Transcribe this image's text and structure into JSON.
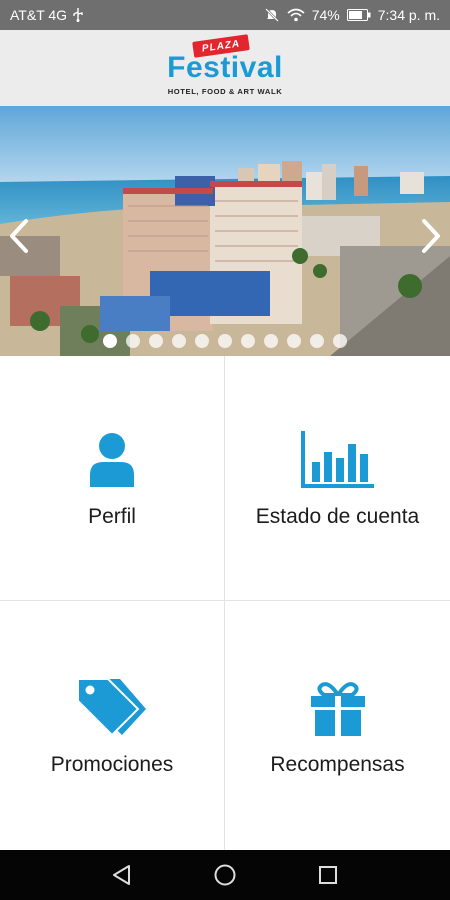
{
  "status_bar": {
    "carrier": "AT&T 4G",
    "battery": "74%",
    "time": "7:34 p. m.",
    "icons": [
      "usb-icon",
      "mute-icon",
      "wifi-icon",
      "battery-icon"
    ]
  },
  "header": {
    "logo_badge": "PLAZA",
    "logo_title": "Festival",
    "logo_subtitle": "HOTEL, FOOD & ART WALK"
  },
  "carousel": {
    "slide_count": 11,
    "active_index": 0,
    "prev_icon": "chevron-left-icon",
    "next_icon": "chevron-right-icon"
  },
  "menu": {
    "items": [
      {
        "label": "Perfil",
        "icon": "user-icon"
      },
      {
        "label": "Estado de cuenta",
        "icon": "bar-chart-icon"
      },
      {
        "label": "Promociones",
        "icon": "tags-icon"
      },
      {
        "label": "Recompensas",
        "icon": "gift-icon"
      }
    ]
  },
  "nav_bar": {
    "icons": [
      "back-icon",
      "home-icon",
      "recents-icon"
    ]
  },
  "colors": {
    "accent": "#1b9ad6",
    "status_bar": "#6f6f6f",
    "header_bg": "#ececec",
    "nav_bar": "#050505",
    "badge": "#e3262d"
  }
}
